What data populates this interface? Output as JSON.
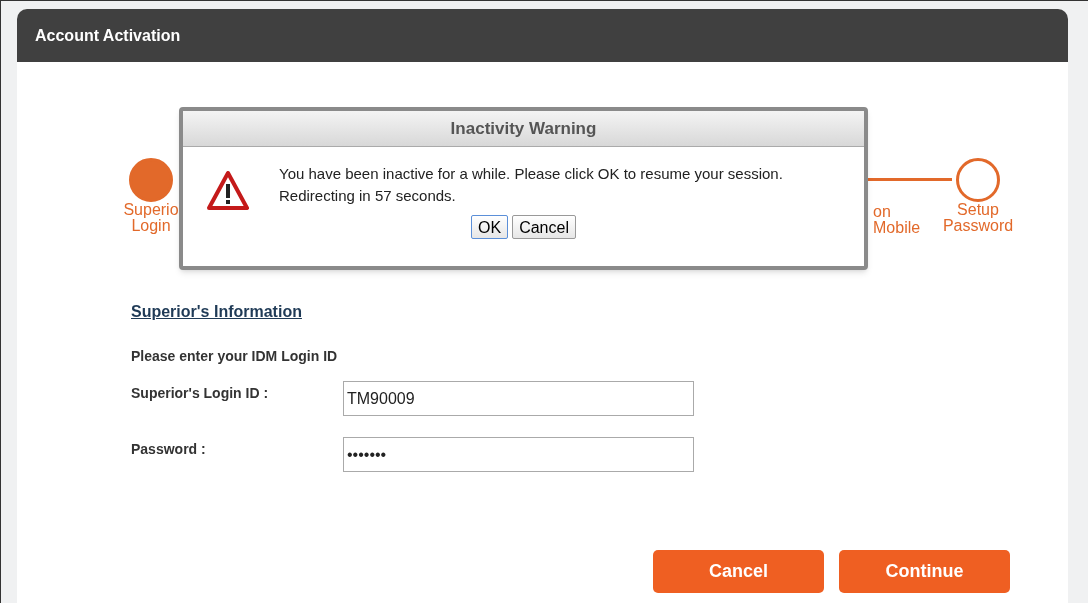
{
  "panel": {
    "title": "Account Activation"
  },
  "steps": [
    {
      "label": [
        "Superio",
        "Login"
      ],
      "completed": true
    },
    {
      "label": [
        "on",
        "Mobile"
      ]
    },
    {
      "label": [
        "Setup",
        "Password"
      ],
      "completed": false
    }
  ],
  "form": {
    "heading": "Superior's Information",
    "instruction": "Please enter your IDM Login ID",
    "fields": [
      {
        "label": "Superior's Login ID :",
        "value": "TM90009"
      },
      {
        "label": "Password :",
        "value": "•••••••"
      }
    ],
    "buttons": [
      "Cancel",
      "Continue"
    ]
  },
  "dialog": {
    "title": "Inactivity Warning",
    "message": [
      "You have been inactive for a while. Please click OK to resume your session.",
      "Redirecting in 57 seconds."
    ],
    "buttons": [
      {
        "label": "OK",
        "focused": true
      },
      {
        "label": "Cancel",
        "focused": false
      }
    ]
  }
}
